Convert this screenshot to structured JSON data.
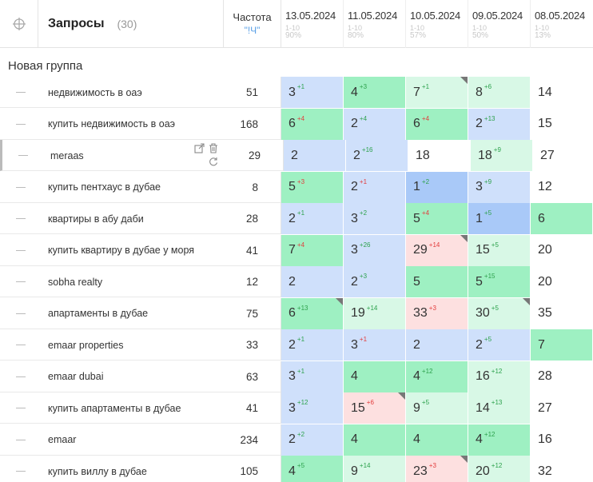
{
  "header": {
    "title": "Запросы",
    "count": "(30)",
    "frequency_label": "Частота",
    "frequency_sub": "\"!Ч\"",
    "dates": [
      {
        "date": "13.05.2024",
        "range": "1-10",
        "pct": "90%"
      },
      {
        "date": "11.05.2024",
        "range": "1-10",
        "pct": "80%"
      },
      {
        "date": "10.05.2024",
        "range": "1-10",
        "pct": "57%"
      },
      {
        "date": "09.05.2024",
        "range": "1-10",
        "pct": "50%"
      },
      {
        "date": "08.05.2024",
        "range": "1-10",
        "pct": "13%"
      }
    ]
  },
  "group": {
    "title": "Новая группа"
  },
  "colors": {
    "blue": "#cfe0fb",
    "blue_strong": "#a9c9f8",
    "green": "#9ef0c2",
    "green_light": "#d8f8e6",
    "red": "#fde0e0",
    "white": "#ffffff"
  },
  "rows": [
    {
      "keyword": "недвижимость в оаэ",
      "freq": "51",
      "cells": [
        {
          "v": "3",
          "d": "+1",
          "dir": "up",
          "bg": "blue"
        },
        {
          "v": "4",
          "d": "+3",
          "dir": "up",
          "bg": "green"
        },
        {
          "v": "7",
          "d": "+1",
          "dir": "up",
          "bg": "green_light",
          "corner": true
        },
        {
          "v": "8",
          "d": "+6",
          "dir": "up",
          "bg": "green_light"
        },
        {
          "v": "14",
          "d": "",
          "dir": "",
          "bg": "white"
        }
      ]
    },
    {
      "keyword": "купить недвижимость в оаэ",
      "freq": "168",
      "cells": [
        {
          "v": "6",
          "d": "+4",
          "dir": "dn",
          "bg": "green"
        },
        {
          "v": "2",
          "d": "+4",
          "dir": "up",
          "bg": "blue"
        },
        {
          "v": "6",
          "d": "+4",
          "dir": "dn",
          "bg": "green"
        },
        {
          "v": "2",
          "d": "+13",
          "dir": "up",
          "bg": "blue"
        },
        {
          "v": "15",
          "d": "",
          "dir": "",
          "bg": "white"
        }
      ]
    },
    {
      "keyword": "meraas",
      "freq": "29",
      "active": true,
      "cells": [
        {
          "v": "2",
          "d": "",
          "dir": "",
          "bg": "blue"
        },
        {
          "v": "2",
          "d": "+16",
          "dir": "up",
          "bg": "blue"
        },
        {
          "v": "18",
          "d": "",
          "dir": "",
          "bg": "white"
        },
        {
          "v": "18",
          "d": "+9",
          "dir": "up",
          "bg": "green_light"
        },
        {
          "v": "27",
          "d": "",
          "dir": "",
          "bg": "white"
        }
      ]
    },
    {
      "keyword": "купить пентхаус в дубае",
      "freq": "8",
      "cells": [
        {
          "v": "5",
          "d": "+3",
          "dir": "dn",
          "bg": "green"
        },
        {
          "v": "2",
          "d": "+1",
          "dir": "dn",
          "bg": "blue"
        },
        {
          "v": "1",
          "d": "+2",
          "dir": "up",
          "bg": "blue_strong"
        },
        {
          "v": "3",
          "d": "+9",
          "dir": "up",
          "bg": "blue"
        },
        {
          "v": "12",
          "d": "",
          "dir": "",
          "bg": "white"
        }
      ]
    },
    {
      "keyword": "квартиры в абу даби",
      "freq": "28",
      "cells": [
        {
          "v": "2",
          "d": "+1",
          "dir": "up",
          "bg": "blue"
        },
        {
          "v": "3",
          "d": "+2",
          "dir": "up",
          "bg": "blue"
        },
        {
          "v": "5",
          "d": "+4",
          "dir": "dn",
          "bg": "green"
        },
        {
          "v": "1",
          "d": "+5",
          "dir": "up",
          "bg": "blue_strong"
        },
        {
          "v": "6",
          "d": "",
          "dir": "",
          "bg": "green"
        }
      ]
    },
    {
      "keyword": "купить квартиру в дубае у моря",
      "freq": "41",
      "cells": [
        {
          "v": "7",
          "d": "+4",
          "dir": "dn",
          "bg": "green"
        },
        {
          "v": "3",
          "d": "+26",
          "dir": "up",
          "bg": "blue"
        },
        {
          "v": "29",
          "d": "+14",
          "dir": "dn",
          "bg": "red",
          "corner": true
        },
        {
          "v": "15",
          "d": "+5",
          "dir": "up",
          "bg": "green_light"
        },
        {
          "v": "20",
          "d": "",
          "dir": "",
          "bg": "white"
        }
      ]
    },
    {
      "keyword": "sobha realty",
      "freq": "12",
      "cells": [
        {
          "v": "2",
          "d": "",
          "dir": "",
          "bg": "blue"
        },
        {
          "v": "2",
          "d": "+3",
          "dir": "up",
          "bg": "blue"
        },
        {
          "v": "5",
          "d": "",
          "dir": "",
          "bg": "green"
        },
        {
          "v": "5",
          "d": "+15",
          "dir": "up",
          "bg": "green"
        },
        {
          "v": "20",
          "d": "",
          "dir": "",
          "bg": "white"
        }
      ]
    },
    {
      "keyword": "апартаменты в дубае",
      "freq": "75",
      "cells": [
        {
          "v": "6",
          "d": "+13",
          "dir": "up",
          "bg": "green",
          "corner": true
        },
        {
          "v": "19",
          "d": "+14",
          "dir": "up",
          "bg": "green_light"
        },
        {
          "v": "33",
          "d": "+3",
          "dir": "dn",
          "bg": "red"
        },
        {
          "v": "30",
          "d": "+5",
          "dir": "up",
          "bg": "green_light",
          "corner": true
        },
        {
          "v": "35",
          "d": "",
          "dir": "",
          "bg": "white"
        }
      ]
    },
    {
      "keyword": "emaar properties",
      "freq": "33",
      "cells": [
        {
          "v": "2",
          "d": "+1",
          "dir": "up",
          "bg": "blue"
        },
        {
          "v": "3",
          "d": "+1",
          "dir": "dn",
          "bg": "blue"
        },
        {
          "v": "2",
          "d": "",
          "dir": "",
          "bg": "blue"
        },
        {
          "v": "2",
          "d": "+5",
          "dir": "up",
          "bg": "blue"
        },
        {
          "v": "7",
          "d": "",
          "dir": "",
          "bg": "green"
        }
      ]
    },
    {
      "keyword": "emaar dubai",
      "freq": "63",
      "cells": [
        {
          "v": "3",
          "d": "+1",
          "dir": "up",
          "bg": "blue"
        },
        {
          "v": "4",
          "d": "",
          "dir": "",
          "bg": "green"
        },
        {
          "v": "4",
          "d": "+12",
          "dir": "up",
          "bg": "green"
        },
        {
          "v": "16",
          "d": "+12",
          "dir": "up",
          "bg": "green_light"
        },
        {
          "v": "28",
          "d": "",
          "dir": "",
          "bg": "white"
        }
      ]
    },
    {
      "keyword": "купить апартаменты в дубае",
      "freq": "41",
      "cells": [
        {
          "v": "3",
          "d": "+12",
          "dir": "up",
          "bg": "blue"
        },
        {
          "v": "15",
          "d": "+6",
          "dir": "dn",
          "bg": "red",
          "corner": true
        },
        {
          "v": "9",
          "d": "+5",
          "dir": "up",
          "bg": "green_light"
        },
        {
          "v": "14",
          "d": "+13",
          "dir": "up",
          "bg": "green_light"
        },
        {
          "v": "27",
          "d": "",
          "dir": "",
          "bg": "white"
        }
      ]
    },
    {
      "keyword": "emaar",
      "freq": "234",
      "cells": [
        {
          "v": "2",
          "d": "+2",
          "dir": "up",
          "bg": "blue"
        },
        {
          "v": "4",
          "d": "",
          "dir": "",
          "bg": "green"
        },
        {
          "v": "4",
          "d": "",
          "dir": "",
          "bg": "green"
        },
        {
          "v": "4",
          "d": "+12",
          "dir": "up",
          "bg": "green"
        },
        {
          "v": "16",
          "d": "",
          "dir": "",
          "bg": "white"
        }
      ]
    },
    {
      "keyword": "купить виллу в дубае",
      "freq": "105",
      "cells": [
        {
          "v": "4",
          "d": "+5",
          "dir": "up",
          "bg": "green"
        },
        {
          "v": "9",
          "d": "+14",
          "dir": "up",
          "bg": "green_light"
        },
        {
          "v": "23",
          "d": "+3",
          "dir": "dn",
          "bg": "red",
          "corner": true
        },
        {
          "v": "20",
          "d": "+12",
          "dir": "up",
          "bg": "green_light"
        },
        {
          "v": "32",
          "d": "",
          "dir": "",
          "bg": "white"
        }
      ]
    }
  ]
}
